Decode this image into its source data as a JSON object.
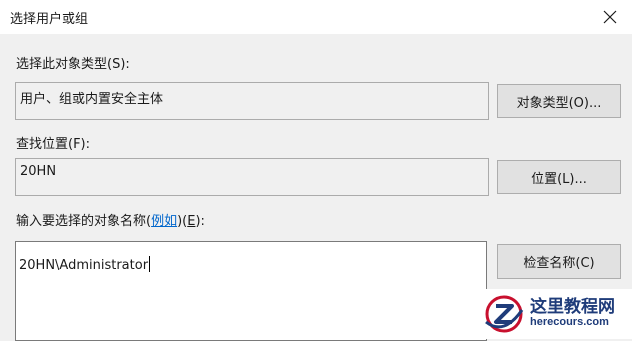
{
  "window": {
    "title": "选择用户或组"
  },
  "object_types": {
    "label": "选择此对象类型(S):",
    "value": "用户、组或内置安全主体",
    "button": "对象类型(O)..."
  },
  "location": {
    "label": "查找位置(F):",
    "value": "20HN",
    "button": "位置(L)..."
  },
  "object_names": {
    "label_prefix": "输入要选择的对象名称(",
    "label_link": "例如",
    "label_suffix_open": ")(",
    "label_accel": "E",
    "label_suffix_close": "):",
    "value": "20HN\\Administrator",
    "button": "检查名称(C)"
  },
  "watermark": {
    "name": "这里教程网",
    "url": "herecours.com"
  },
  "icons": {
    "close": "close-icon",
    "logo": "logo-icon"
  }
}
